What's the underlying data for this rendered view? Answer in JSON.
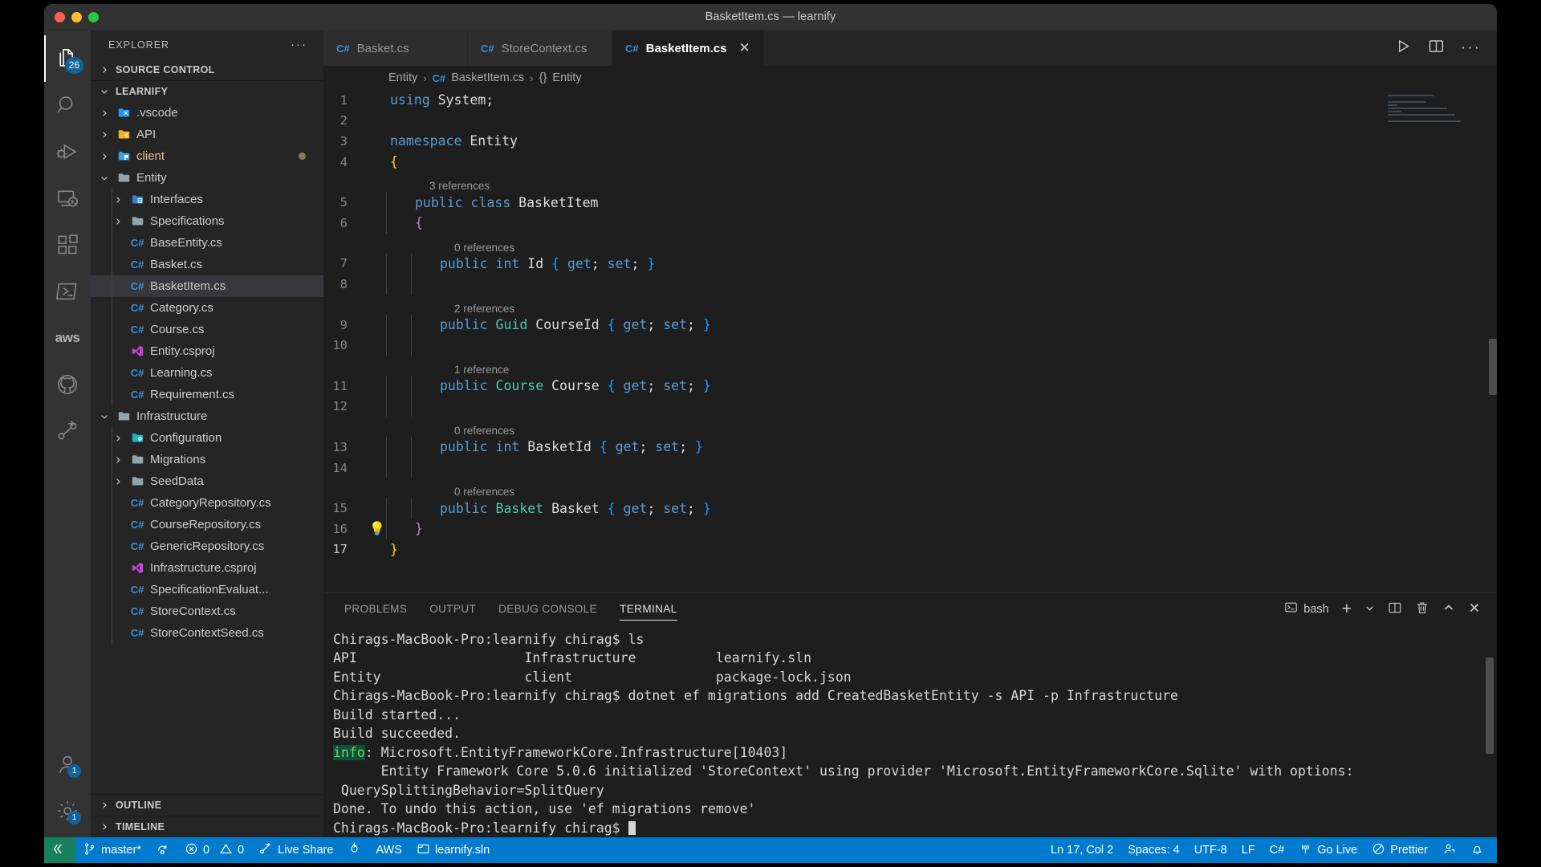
{
  "window": {
    "title": "BasketItem.cs — learnify"
  },
  "activitybar": {
    "items": [
      {
        "name": "explorer",
        "icon": "files-icon",
        "badge": "26",
        "active": true
      },
      {
        "name": "search",
        "icon": "search-icon",
        "badge": ""
      },
      {
        "name": "run-and-debug",
        "icon": "debug-icon",
        "badge": ""
      },
      {
        "name": "remote-explorer",
        "icon": "remote-icon",
        "badge": ""
      },
      {
        "name": "extensions",
        "icon": "extensions-icon",
        "badge": ""
      },
      {
        "name": "terminal-panel",
        "icon": "powershell-icon",
        "badge": ""
      },
      {
        "name": "aws-toolkit",
        "icon": "aws-icon",
        "badge": ""
      },
      {
        "name": "github",
        "icon": "github-icon",
        "badge": ""
      },
      {
        "name": "live-share",
        "icon": "live-share-icon",
        "badge": ""
      }
    ],
    "bottom": [
      {
        "name": "accounts",
        "icon": "account-icon",
        "badge": "1"
      },
      {
        "name": "manage",
        "icon": "gear-icon",
        "badge": "1"
      }
    ]
  },
  "sidebar": {
    "header": "EXPLORER",
    "more_label": "···",
    "source_control": "SOURCE CONTROL",
    "workspace": "LEARNIFY",
    "outline": "OUTLINE",
    "timeline": "TIMELINE",
    "tree": [
      {
        "label": ".vscode",
        "kind": "folder",
        "icon": "folder-vscode-icon",
        "depth": 1,
        "expanded": false
      },
      {
        "label": "API",
        "kind": "folder",
        "icon": "folder-api-icon",
        "depth": 1,
        "expanded": false
      },
      {
        "label": "client",
        "kind": "folder",
        "icon": "folder-client-icon",
        "depth": 1,
        "expanded": false,
        "modified": true
      },
      {
        "label": "Entity",
        "kind": "folder",
        "icon": "folder-icon",
        "depth": 1,
        "expanded": true
      },
      {
        "label": "Interfaces",
        "kind": "folder",
        "icon": "folder-interface-icon",
        "depth": 2,
        "expanded": false
      },
      {
        "label": "Specifications",
        "kind": "folder",
        "icon": "folder-icon",
        "depth": 2,
        "expanded": false
      },
      {
        "label": "BaseEntity.cs",
        "kind": "file",
        "icon": "csharp-icon",
        "depth": 2
      },
      {
        "label": "Basket.cs",
        "kind": "file",
        "icon": "csharp-icon",
        "depth": 2
      },
      {
        "label": "BasketItem.cs",
        "kind": "file",
        "icon": "csharp-icon",
        "depth": 2,
        "selected": true
      },
      {
        "label": "Category.cs",
        "kind": "file",
        "icon": "csharp-icon",
        "depth": 2
      },
      {
        "label": "Course.cs",
        "kind": "file",
        "icon": "csharp-icon",
        "depth": 2
      },
      {
        "label": "Entity.csproj",
        "kind": "file",
        "icon": "csproj-icon",
        "depth": 2
      },
      {
        "label": "Learning.cs",
        "kind": "file",
        "icon": "csharp-icon",
        "depth": 2
      },
      {
        "label": "Requirement.cs",
        "kind": "file",
        "icon": "csharp-icon",
        "depth": 2
      },
      {
        "label": "Infrastructure",
        "kind": "folder",
        "icon": "folder-icon",
        "depth": 1,
        "expanded": true
      },
      {
        "label": "Configuration",
        "kind": "folder",
        "icon": "folder-config-icon",
        "depth": 2,
        "expanded": false
      },
      {
        "label": "Migrations",
        "kind": "folder",
        "icon": "folder-icon",
        "depth": 2,
        "expanded": false
      },
      {
        "label": "SeedData",
        "kind": "folder",
        "icon": "folder-icon",
        "depth": 2,
        "expanded": false
      },
      {
        "label": "CategoryRepository.cs",
        "kind": "file",
        "icon": "csharp-icon",
        "depth": 2
      },
      {
        "label": "CourseRepository.cs",
        "kind": "file",
        "icon": "csharp-icon",
        "depth": 2
      },
      {
        "label": "GenericRepository.cs",
        "kind": "file",
        "icon": "csharp-icon",
        "depth": 2
      },
      {
        "label": "Infrastructure.csproj",
        "kind": "file",
        "icon": "csproj-icon",
        "depth": 2
      },
      {
        "label": "SpecificationEvaluat...",
        "kind": "file",
        "icon": "csharp-icon",
        "depth": 2
      },
      {
        "label": "StoreContext.cs",
        "kind": "file",
        "icon": "csharp-icon",
        "depth": 2
      },
      {
        "label": "StoreContextSeed.cs",
        "kind": "file",
        "icon": "csharp-icon",
        "depth": 2
      }
    ]
  },
  "tabs": [
    {
      "label": "Basket.cs",
      "icon": "csharp-icon",
      "active": false,
      "closable": false
    },
    {
      "label": "StoreContext.cs",
      "icon": "csharp-icon",
      "active": false,
      "closable": false
    },
    {
      "label": "BasketItem.cs",
      "icon": "csharp-icon",
      "active": true,
      "closable": true,
      "close_label": "✕"
    }
  ],
  "editor_actions": [
    {
      "name": "run-code-button",
      "icon": "play-icon"
    },
    {
      "name": "split-editor-button",
      "icon": "split-editor-icon"
    },
    {
      "name": "more-actions-button",
      "icon": "ellipsis-icon",
      "label": "···"
    }
  ],
  "breadcrumb": {
    "items": [
      "Entity",
      "BasketItem.cs",
      "Entity"
    ],
    "file_icon": "csharp-icon",
    "symbol_icon": "{}",
    "separator": "›"
  },
  "code": {
    "lines": [
      {
        "n": 1,
        "lens": "",
        "indent": 0,
        "tokens": [
          {
            "t": "using",
            "c": "kw"
          },
          {
            "t": " System;",
            "c": "white"
          }
        ]
      },
      {
        "n": 2,
        "lens": "",
        "indent": 0,
        "tokens": []
      },
      {
        "n": 3,
        "lens": "",
        "indent": 0,
        "tokens": [
          {
            "t": "namespace",
            "c": "kw"
          },
          {
            "t": " Entity",
            "c": "white"
          }
        ]
      },
      {
        "n": 4,
        "lens": "",
        "indent": 0,
        "tokens": [
          {
            "t": "{",
            "c": "brace-y"
          }
        ]
      },
      {
        "n": 5,
        "lens": "3 references",
        "indent": 1,
        "tokens": [
          {
            "t": "public",
            "c": "kw"
          },
          {
            "t": " ",
            "c": "white"
          },
          {
            "t": "class",
            "c": "kw"
          },
          {
            "t": " BasketItem",
            "c": "white"
          }
        ]
      },
      {
        "n": 6,
        "lens": "",
        "indent": 1,
        "tokens": [
          {
            "t": "{",
            "c": "brace-p"
          }
        ]
      },
      {
        "n": 7,
        "lens": "0 references",
        "indent": 2,
        "tokens": [
          {
            "t": "public",
            "c": "kw"
          },
          {
            "t": " ",
            "c": "white"
          },
          {
            "t": "int",
            "c": "kw"
          },
          {
            "t": " Id ",
            "c": "white"
          },
          {
            "t": "{",
            "c": "brace-b"
          },
          {
            "t": " ",
            "c": "white"
          },
          {
            "t": "get",
            "c": "kw"
          },
          {
            "t": "; ",
            "c": "white"
          },
          {
            "t": "set",
            "c": "kw"
          },
          {
            "t": "; ",
            "c": "white"
          },
          {
            "t": "}",
            "c": "brace-b"
          }
        ]
      },
      {
        "n": 8,
        "lens": "",
        "indent": 2,
        "tokens": []
      },
      {
        "n": 9,
        "lens": "2 references",
        "indent": 2,
        "tokens": [
          {
            "t": "public",
            "c": "kw"
          },
          {
            "t": " ",
            "c": "white"
          },
          {
            "t": "Guid",
            "c": "type"
          },
          {
            "t": " CourseId ",
            "c": "white"
          },
          {
            "t": "{",
            "c": "brace-b"
          },
          {
            "t": " ",
            "c": "white"
          },
          {
            "t": "get",
            "c": "kw"
          },
          {
            "t": "; ",
            "c": "white"
          },
          {
            "t": "set",
            "c": "kw"
          },
          {
            "t": "; ",
            "c": "white"
          },
          {
            "t": "}",
            "c": "brace-b"
          }
        ]
      },
      {
        "n": 10,
        "lens": "",
        "indent": 2,
        "tokens": []
      },
      {
        "n": 11,
        "lens": "1 reference",
        "indent": 2,
        "tokens": [
          {
            "t": "public",
            "c": "kw"
          },
          {
            "t": " ",
            "c": "white"
          },
          {
            "t": "Course",
            "c": "type"
          },
          {
            "t": " Course ",
            "c": "white"
          },
          {
            "t": "{",
            "c": "brace-b"
          },
          {
            "t": " ",
            "c": "white"
          },
          {
            "t": "get",
            "c": "kw"
          },
          {
            "t": "; ",
            "c": "white"
          },
          {
            "t": "set",
            "c": "kw"
          },
          {
            "t": "; ",
            "c": "white"
          },
          {
            "t": "}",
            "c": "brace-b"
          }
        ]
      },
      {
        "n": 12,
        "lens": "",
        "indent": 2,
        "tokens": []
      },
      {
        "n": 13,
        "lens": "0 references",
        "indent": 2,
        "tokens": [
          {
            "t": "public",
            "c": "kw"
          },
          {
            "t": " ",
            "c": "white"
          },
          {
            "t": "int",
            "c": "kw"
          },
          {
            "t": " BasketId ",
            "c": "white"
          },
          {
            "t": "{",
            "c": "brace-b"
          },
          {
            "t": " ",
            "c": "white"
          },
          {
            "t": "get",
            "c": "kw"
          },
          {
            "t": "; ",
            "c": "white"
          },
          {
            "t": "set",
            "c": "kw"
          },
          {
            "t": "; ",
            "c": "white"
          },
          {
            "t": "}",
            "c": "brace-b"
          }
        ]
      },
      {
        "n": 14,
        "lens": "",
        "indent": 2,
        "tokens": []
      },
      {
        "n": 15,
        "lens": "0 references",
        "indent": 2,
        "tokens": [
          {
            "t": "public",
            "c": "kw"
          },
          {
            "t": " ",
            "c": "white"
          },
          {
            "t": "Basket",
            "c": "type"
          },
          {
            "t": " Basket ",
            "c": "white"
          },
          {
            "t": "{",
            "c": "brace-b"
          },
          {
            "t": " ",
            "c": "white"
          },
          {
            "t": "get",
            "c": "kw"
          },
          {
            "t": "; ",
            "c": "white"
          },
          {
            "t": "set",
            "c": "kw"
          },
          {
            "t": "; ",
            "c": "white"
          },
          {
            "t": "}",
            "c": "brace-b"
          }
        ]
      },
      {
        "n": 16,
        "lens": "",
        "indent": 1,
        "bulb": true,
        "tokens": [
          {
            "t": "}",
            "c": "brace-p"
          }
        ]
      },
      {
        "n": 17,
        "lens": "",
        "indent": 0,
        "current": true,
        "tokens": [
          {
            "t": "}",
            "c": "brace-y"
          }
        ]
      }
    ]
  },
  "panel": {
    "tabs": [
      {
        "label": "PROBLEMS",
        "active": false
      },
      {
        "label": "OUTPUT",
        "active": false
      },
      {
        "label": "DEBUG CONSOLE",
        "active": false
      },
      {
        "label": "TERMINAL",
        "active": true
      }
    ],
    "shell": "bash",
    "actions": [
      {
        "name": "new-terminal-button",
        "icon": "plus-icon",
        "label": "+"
      },
      {
        "name": "terminal-dropdown-button",
        "icon": "chevron-down-icon",
        "label": "⌄"
      },
      {
        "name": "split-terminal-button",
        "icon": "split-terminal-icon"
      },
      {
        "name": "kill-terminal-button",
        "icon": "trash-icon"
      },
      {
        "name": "maximize-panel-button",
        "icon": "chevron-up-icon",
        "label": "⌃"
      },
      {
        "name": "close-panel-button",
        "icon": "close-icon",
        "label": "✕"
      }
    ],
    "terminal_lines": [
      {
        "segments": [
          {
            "text": "Chirags-MacBook-Pro:learnify chirag$ ls"
          }
        ]
      },
      {
        "segments": [
          {
            "text": "API                     Infrastructure          learnify.sln"
          }
        ]
      },
      {
        "segments": [
          {
            "text": "Entity                  client                  package-lock.json"
          }
        ]
      },
      {
        "segments": [
          {
            "text": "Chirags-MacBook-Pro:learnify chirag$ dotnet ef migrations add CreatedBasketEntity -s API -p Infrastructure"
          }
        ]
      },
      {
        "segments": [
          {
            "text": "Build started..."
          }
        ]
      },
      {
        "segments": [
          {
            "text": "Build succeeded."
          }
        ]
      },
      {
        "segments": [
          {
            "text": "info",
            "style": "green"
          },
          {
            "text": ": Microsoft.EntityFrameworkCore.Infrastructure[10403]"
          }
        ]
      },
      {
        "segments": [
          {
            "text": "      Entity Framework Core 5.0.6 initialized 'StoreContext' using provider 'Microsoft.EntityFrameworkCore.Sqlite' with options:"
          }
        ]
      },
      {
        "segments": [
          {
            "text": " QuerySplittingBehavior=SplitQuery"
          }
        ]
      },
      {
        "segments": [
          {
            "text": "Done. To undo this action, use 'ef migrations remove'"
          }
        ]
      },
      {
        "segments": [
          {
            "text": "Chirags-MacBook-Pro:learnify chirag$ "
          },
          {
            "text": "",
            "style": "cursor"
          }
        ]
      }
    ]
  },
  "statusbar": {
    "left": [
      {
        "name": "remote-host-indicator",
        "icon": "remote-icon",
        "label": ""
      },
      {
        "name": "scm-branch",
        "icon": "source-control-icon",
        "label": "master*"
      },
      {
        "name": "sync-changes",
        "icon": "sync-icon",
        "label": ""
      },
      {
        "name": "problems",
        "icon": "error-warning-icon",
        "label": "0",
        "label2": "0"
      },
      {
        "name": "live-share",
        "icon": "live-share-icon",
        "label": "Live Share"
      },
      {
        "name": "flame-status",
        "icon": "flame-icon",
        "label": ""
      },
      {
        "name": "aws-status",
        "icon": "aws-icon",
        "label": "AWS"
      },
      {
        "name": "solution-status",
        "icon": "window-icon",
        "label": "learnify.sln"
      }
    ],
    "right": [
      {
        "name": "cursor-position",
        "icon": "",
        "label": "Ln 17, Col 2"
      },
      {
        "name": "indentation",
        "icon": "",
        "label": "Spaces: 4"
      },
      {
        "name": "encoding",
        "icon": "",
        "label": "UTF-8"
      },
      {
        "name": "end-of-line",
        "icon": "",
        "label": "LF"
      },
      {
        "name": "language-mode",
        "icon": "",
        "label": "C#"
      },
      {
        "name": "go-live",
        "icon": "broadcast-icon",
        "label": "Go Live"
      },
      {
        "name": "prettier",
        "icon": "prettier-icon",
        "label": "Prettier"
      },
      {
        "name": "feedback",
        "icon": "feedback-icon",
        "label": ""
      },
      {
        "name": "notifications",
        "icon": "bell-icon",
        "label": ""
      }
    ]
  },
  "colors": {
    "accent": "#007acc",
    "remote_green": "#16825d",
    "badge_blue": "#0e639c",
    "modified_amber": "#e2c08d"
  }
}
